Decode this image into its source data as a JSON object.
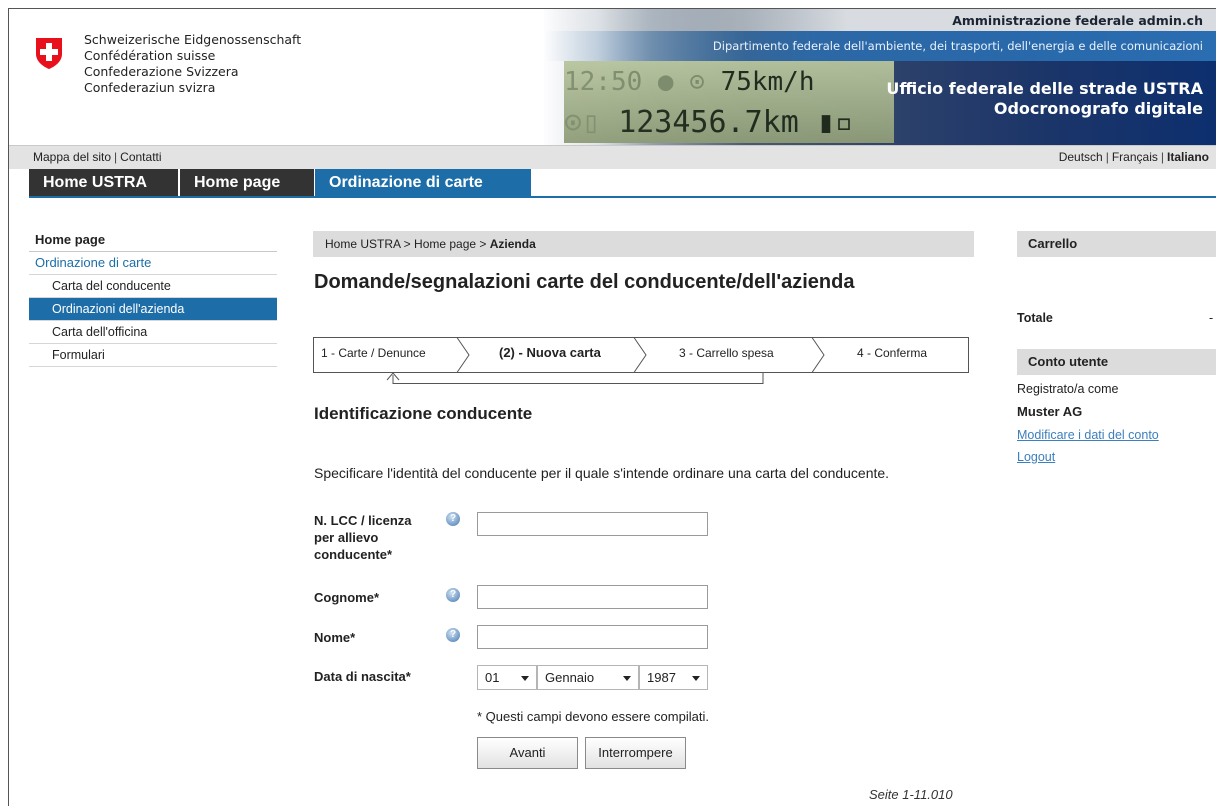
{
  "header": {
    "confederation": [
      "Schweizerische Eidgenossenschaft",
      "Confédération suisse",
      "Confederazione Svizzera",
      "Confederaziun svizra"
    ],
    "admin": "Amministrazione federale admin.ch",
    "department": "Dipartimento federale dell'ambiente, dei trasporti, dell'energia e delle comunicazioni",
    "display_time": "12:50",
    "display_speed": "75km/h",
    "display_odometer": "123456.7km",
    "office_line1": "Ufficio federale delle strade USTRA",
    "office_line2": "Odocronografo digitale"
  },
  "utility": {
    "left": [
      "Mappa del sito",
      "Contatti"
    ],
    "languages": [
      "Deutsch",
      "Français",
      "Italiano"
    ],
    "current_language": "Italiano"
  },
  "nav": {
    "tabs": [
      "Home USTRA",
      "Home page",
      "Ordinazione di carte"
    ],
    "active": "Ordinazione di carte"
  },
  "left_menu": {
    "items": [
      "Home page",
      "Ordinazione di carte",
      "Carta del conducente",
      "Ordinazioni dell'azienda",
      "Carta dell'officina",
      "Formulari"
    ],
    "active": "Ordinazioni dell'azienda"
  },
  "breadcrumb": {
    "path": "Home USTRA > Home page > ",
    "current": "Azienda"
  },
  "title": "Domande/segnalazioni carte del conducente/dell'azienda",
  "steps": [
    "1 - Carte / Denunce",
    "(2) - Nuova carta",
    "3 - Carrello spesa",
    "4 - Conferma"
  ],
  "current_step": "(2) - Nuova carta",
  "section_title": "Identificazione conducente",
  "intro": "Specificare l'identità del conducente per il quale s'intende ordinare una carta del conducente.",
  "form": {
    "lcc_label_lines": [
      "N. LCC / licenza",
      "per allievo",
      "conducente*"
    ],
    "lcc_value": "",
    "surname_label": "Cognome*",
    "surname_value": "",
    "name_label": "Nome*",
    "name_value": "",
    "dob_label": "Data di nascita*",
    "dob_day": "01",
    "dob_month": "Gennaio",
    "dob_year": "1987",
    "required_note": "* Questi campi devono essere compilati.",
    "next_button": "Avanti",
    "cancel_button": "Interrompere"
  },
  "page_number": "Seite 1-11.010",
  "sidebar": {
    "cart_title": "Carrello",
    "total_label": "Totale",
    "total_value": "-",
    "account_title": "Conto utente",
    "registered_as": "Registrato/a come",
    "user": "Muster AG",
    "edit_link": "Modificare i dati del conto",
    "logout_link": "Logout"
  },
  "colors": {
    "accent": "#1d6ea8",
    "dark_tab": "#333333",
    "link": "#3c7fbd"
  }
}
